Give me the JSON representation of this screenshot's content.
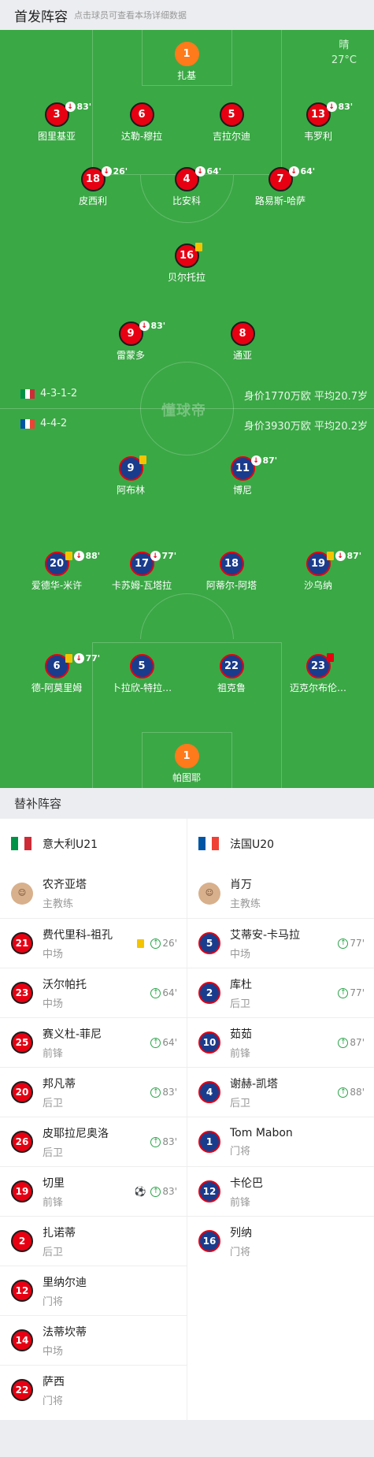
{
  "header": {
    "title": "首发阵容",
    "subtitle": "点击球员可查看本场详细数据"
  },
  "weather": {
    "condition": "晴",
    "temperature": "27°C"
  },
  "watermark": "懂球帝",
  "home_team": {
    "formation": "4-3-1-2",
    "value_text": "身价1770万欧  平均20.7岁",
    "flag_colors": [
      "#009246",
      "#ffffff",
      "#ce2b37"
    ]
  },
  "away_team": {
    "formation": "4-4-2",
    "value_text": "身价3930万欧  平均20.2岁",
    "flag_colors": [
      "#0055a4",
      "#ffffff",
      "#ef4135"
    ]
  },
  "home_players": [
    {
      "number": "1",
      "name": "扎基",
      "gk": true,
      "events": []
    },
    {
      "number": "3",
      "name": "图里基亚",
      "events": [
        "subout"
      ],
      "minute": "83'"
    },
    {
      "number": "6",
      "name": "达勒-穆拉",
      "events": []
    },
    {
      "number": "5",
      "name": "吉拉尔迪",
      "events": []
    },
    {
      "number": "13",
      "name": "韦罗利",
      "events": [
        "subout"
      ],
      "minute": "83'"
    },
    {
      "number": "18",
      "name": "皮西利",
      "events": [
        "subout"
      ],
      "minute": "26'"
    },
    {
      "number": "4",
      "name": "比安科",
      "events": [
        "subout"
      ],
      "minute": "64'"
    },
    {
      "number": "7",
      "name": "路易斯-哈萨",
      "events": [
        "subout"
      ],
      "minute": "64'"
    },
    {
      "number": "16",
      "name": "贝尔托拉",
      "events": [
        "yellow"
      ]
    },
    {
      "number": "9",
      "name": "雷蒙多",
      "events": [
        "subout"
      ],
      "minute": "83'"
    },
    {
      "number": "8",
      "name": "通亚",
      "events": []
    }
  ],
  "away_players": [
    {
      "number": "9",
      "name": "阿布林",
      "events": [
        "yellow"
      ]
    },
    {
      "number": "11",
      "name": "博尼",
      "events": [
        "subout"
      ],
      "minute": "87'"
    },
    {
      "number": "20",
      "name": "爱德华-米许",
      "events": [
        "yellow",
        "subout"
      ],
      "minute": "88'"
    },
    {
      "number": "17",
      "name": "卡苏姆-瓦塔拉",
      "events": [
        "subout"
      ],
      "minute": "77'"
    },
    {
      "number": "18",
      "name": "阿蒂尔-阿塔",
      "events": []
    },
    {
      "number": "19",
      "name": "沙乌纳",
      "events": [
        "yellow",
        "subout"
      ],
      "minute": "87'"
    },
    {
      "number": "6",
      "name": "德-阿莫里姆",
      "events": [
        "yellow",
        "subout"
      ],
      "minute": "77'"
    },
    {
      "number": "5",
      "name": "卜拉欣-特拉…",
      "events": []
    },
    {
      "number": "22",
      "name": "祖克鲁",
      "events": []
    },
    {
      "number": "23",
      "name": "迈克尔布伦…",
      "events": [
        "red"
      ]
    },
    {
      "number": "1",
      "name": "帕图耶",
      "gk": true,
      "events": []
    }
  ],
  "subs_header": "替补阵容",
  "home_subs": {
    "team_name": "意大利U21",
    "coach": {
      "name": "农齐亚塔",
      "role": "主教练"
    },
    "players": [
      {
        "number": "21",
        "name": "费代里科-祖孔",
        "position": "中场",
        "yellow": true,
        "goal": false,
        "minute": "26'"
      },
      {
        "number": "23",
        "name": "沃尔帕托",
        "position": "中场",
        "yellow": false,
        "goal": false,
        "minute": "64'"
      },
      {
        "number": "25",
        "name": "赛义杜-菲尼",
        "position": "前锋",
        "yellow": false,
        "goal": false,
        "minute": "64'"
      },
      {
        "number": "20",
        "name": "邦凡蒂",
        "position": "后卫",
        "yellow": false,
        "goal": false,
        "minute": "83'"
      },
      {
        "number": "26",
        "name": "皮耶拉尼奥洛",
        "position": "后卫",
        "yellow": false,
        "goal": false,
        "minute": "83'"
      },
      {
        "number": "19",
        "name": "切里",
        "position": "前锋",
        "yellow": false,
        "goal": true,
        "minute": "83'"
      },
      {
        "number": "2",
        "name": "扎诺蒂",
        "position": "后卫",
        "yellow": false,
        "goal": false,
        "minute": ""
      },
      {
        "number": "12",
        "name": "里纳尔迪",
        "position": "门将",
        "yellow": false,
        "goal": false,
        "minute": ""
      },
      {
        "number": "14",
        "name": "法蒂坎蒂",
        "position": "中场",
        "yellow": false,
        "goal": false,
        "minute": ""
      },
      {
        "number": "22",
        "name": "萨西",
        "position": "门将",
        "yellow": false,
        "goal": false,
        "minute": ""
      }
    ]
  },
  "away_subs": {
    "team_name": "法国U20",
    "coach": {
      "name": "肖万",
      "role": "主教练"
    },
    "players": [
      {
        "number": "5",
        "name": "艾蒂安-卡马拉",
        "position": "中场",
        "minute": "77'"
      },
      {
        "number": "2",
        "name": "库杜",
        "position": "后卫",
        "minute": "77'"
      },
      {
        "number": "10",
        "name": "茹茹",
        "position": "前锋",
        "minute": "87'"
      },
      {
        "number": "4",
        "name": "谢赫-凯塔",
        "position": "后卫",
        "minute": "88'"
      },
      {
        "number": "1",
        "name": "Tom Mabon",
        "position": "门将",
        "minute": ""
      },
      {
        "number": "12",
        "name": "卡伦巴",
        "position": "前锋",
        "minute": ""
      },
      {
        "number": "16",
        "name": "列纳",
        "position": "门将",
        "minute": ""
      }
    ]
  }
}
